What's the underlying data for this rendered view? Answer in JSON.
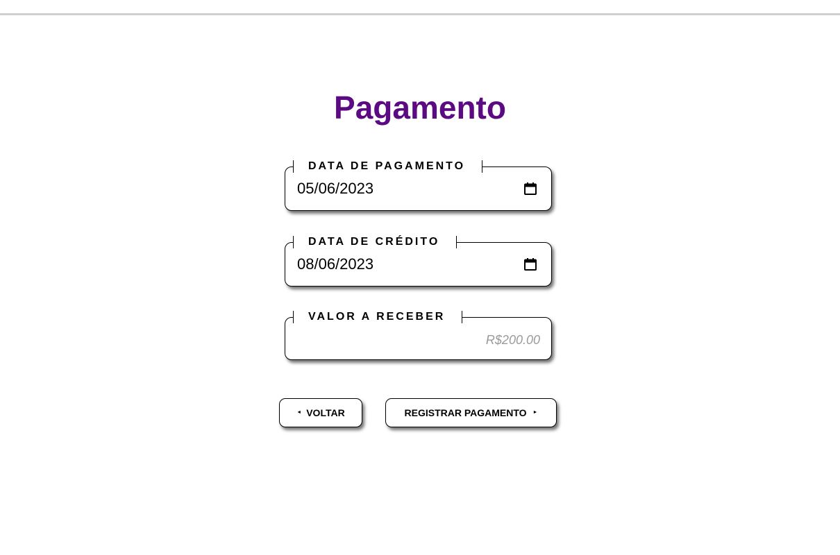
{
  "page": {
    "title": "Pagamento",
    "title_color": "#5b0a82"
  },
  "form": {
    "payment_date": {
      "label": "DATA DE PAGAMENTO",
      "value": "05/06/2023",
      "icon": "calendar-icon"
    },
    "credit_date": {
      "label": "DATA DE CRÉDITO",
      "value": "08/06/2023",
      "icon": "calendar-icon"
    },
    "amount": {
      "label": "VALOR A RECEBER",
      "value": "",
      "placeholder": "R$200.00"
    }
  },
  "actions": {
    "back_label": "VOLTAR",
    "back_icon": "◄",
    "submit_label": "REGISTRAR PAGAMENTO",
    "submit_icon": "►"
  }
}
